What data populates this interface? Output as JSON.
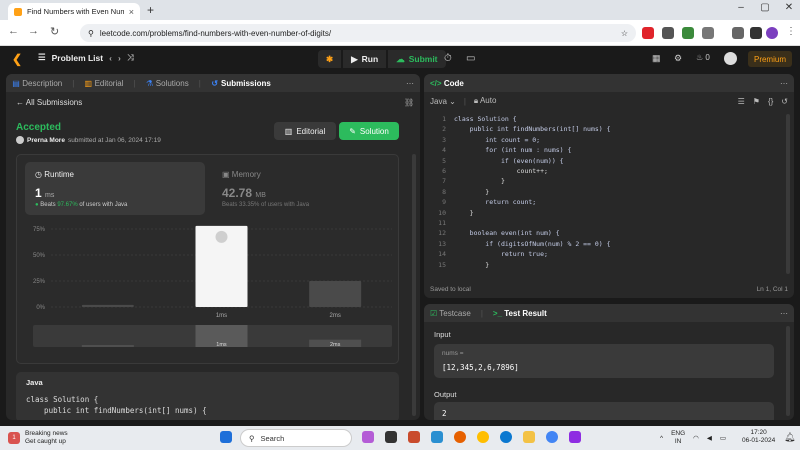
{
  "browser": {
    "tab_title": "Find Numbers with Even Numb",
    "url": "leetcode.com/problems/find-numbers-with-even-number-of-digits/"
  },
  "lc_nav": {
    "problem_list": "Problem List",
    "run": "Run",
    "submit": "Submit",
    "streak": "0",
    "premium": "Premium"
  },
  "left_tabs": [
    "Description",
    "Editorial",
    "Solutions",
    "Submissions"
  ],
  "submission": {
    "back": "All Submissions",
    "status": "Accepted",
    "user": "Prerna More",
    "submitted": "submitted at Jan 06, 2024 17:19",
    "editorial_btn": "Editorial",
    "solution_btn": "Solution",
    "runtime_label": "Runtime",
    "runtime_value": "1",
    "runtime_unit": "ms",
    "runtime_beats_pre": "Beats",
    "runtime_beats_pct": "97.67%",
    "runtime_beats_post": "of users with Java",
    "memory_label": "Memory",
    "memory_value": "42.78",
    "memory_unit": "MB",
    "memory_beats": "Beats 33.35% of users with Java",
    "code_lang": "Java",
    "code_line1": "class Solution {",
    "code_line2": "    public int findNumbers(int[] nums) {"
  },
  "chart_data": {
    "type": "bar",
    "categories": [
      "",
      "1ms",
      "2ms"
    ],
    "values": [
      2,
      78,
      25
    ],
    "ylim": [
      0,
      75
    ],
    "yticks": [
      "0%",
      "25%",
      "50%",
      "75%"
    ],
    "highlight_index": 1,
    "grid": true
  },
  "editor": {
    "title": "Code",
    "lang": "Java",
    "mode": "Auto",
    "status": "Saved to local",
    "position": "Ln 1, Col 1",
    "line_numbers": [
      "1",
      "2",
      "3",
      "4",
      "5",
      "6",
      "7",
      "8",
      "9",
      "10",
      "11",
      "12",
      "13",
      "14",
      "15"
    ],
    "lines": [
      "class Solution {",
      "    public int findNumbers(int[] nums) {",
      "        int count = 0;",
      "        for (int num : nums) {",
      "            if (even(num)) {",
      "                count++;",
      "            }",
      "        }",
      "        return count;",
      "    }",
      "",
      "    boolean even(int num) {",
      "        if (digitsOfNum(num) % 2 == 0) {",
      "            return true;",
      "        }"
    ]
  },
  "testpanel": {
    "tab_testcase": "Testcase",
    "tab_result": "Test Result",
    "input_label": "Input",
    "var_label": "nums =",
    "input_value": "[12,345,2,6,7896]",
    "output_label": "Output",
    "output_value": "2"
  },
  "taskbar": {
    "news_title": "Breaking news",
    "news_sub": "Get caught up",
    "search": "Search",
    "lang1": "ENG",
    "lang2": "IN",
    "time": "17:20",
    "date": "06-01-2024"
  }
}
